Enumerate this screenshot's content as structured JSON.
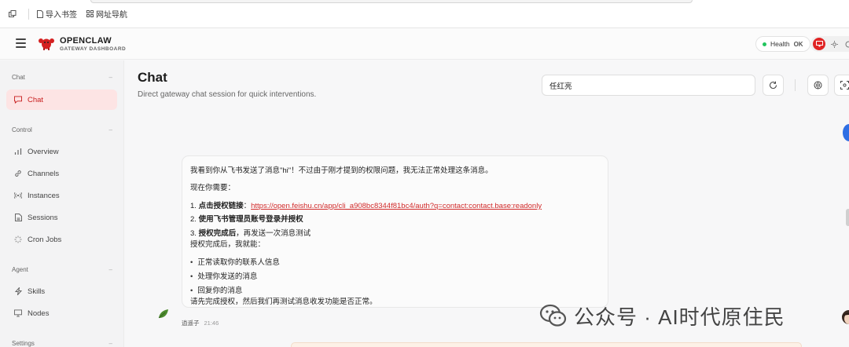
{
  "browser": {
    "bookmarks": [
      {
        "label": "导入书签",
        "icon": "document-icon"
      },
      {
        "label": "网址导航",
        "icon": "grid-icon"
      }
    ]
  },
  "app": {
    "title": "OPENCLAW",
    "subtitle": "GATEWAY DASHBOARD",
    "health_label": "Health",
    "health_status": "OK",
    "accent_color": "#e02424",
    "health_color": "#22c55e"
  },
  "sidebar": {
    "sections": [
      {
        "title": "Chat",
        "items": [
          {
            "label": "Chat",
            "icon": "chat-icon",
            "active": true
          }
        ]
      },
      {
        "title": "Control",
        "items": [
          {
            "label": "Overview",
            "icon": "bar-chart-icon"
          },
          {
            "label": "Channels",
            "icon": "link-icon"
          },
          {
            "label": "Instances",
            "icon": "broadcast-icon"
          },
          {
            "label": "Sessions",
            "icon": "document-icon"
          },
          {
            "label": "Cron Jobs",
            "icon": "loader-icon"
          }
        ]
      },
      {
        "title": "Agent",
        "items": [
          {
            "label": "Skills",
            "icon": "bolt-icon"
          },
          {
            "label": "Nodes",
            "icon": "monitor-icon"
          }
        ]
      },
      {
        "title": "Settings",
        "items": []
      }
    ]
  },
  "main": {
    "title": "Chat",
    "subtitle": "Direct gateway chat session for quick interventions.",
    "session_value": "任红亮"
  },
  "message": {
    "intro": "我看到你从飞书发送了消息\"hi\"！不过由于刚才提到的权限问题，我无法正常处理这条消息。",
    "need": "现在你需要：",
    "step1_num": "1. ",
    "step1_bold": "点击授权链接",
    "step1_colon": "：",
    "step1_link": "https://open.feishu.cn/app/cli_a908bc8344f81bc4/auth?q=contact:contact.base:readonly",
    "step2_num": "2. ",
    "step2_bold": "使用飞书管理员账号登录并授权",
    "step3_num": "3. ",
    "step3_bold": "授权完成后",
    "step3_rest": "，再发送一次消息测试",
    "after": "授权完成后，我就能：",
    "bullets": [
      "正常读取你的联系人信息",
      "处理你发送的消息",
      "回复你的消息"
    ],
    "closing": "请先完成授权，然后我们再测试消息收发功能是否正常。",
    "sender": "逍遥子",
    "time": "21:46"
  },
  "watermark": {
    "text": "公众号 · AI时代原住民"
  }
}
